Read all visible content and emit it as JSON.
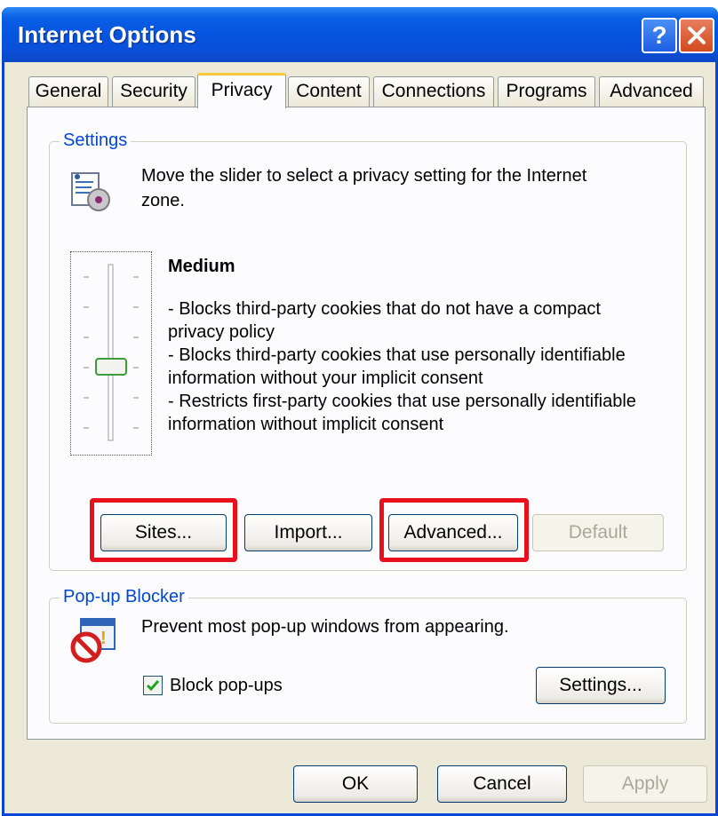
{
  "window": {
    "title": "Internet Options"
  },
  "tabs": [
    {
      "label": "General"
    },
    {
      "label": "Security"
    },
    {
      "label": "Privacy",
      "active": true
    },
    {
      "label": "Content"
    },
    {
      "label": "Connections"
    },
    {
      "label": "Programs"
    },
    {
      "label": "Advanced"
    }
  ],
  "settings": {
    "group_label": "Settings",
    "instruction_line1": "Move the slider to select a privacy setting for the Internet",
    "instruction_line2": "zone.",
    "level_title": "Medium",
    "slider_level": "3 of 6 (middle)",
    "description_lines": [
      "- Blocks third-party cookies that do not have a compact",
      "privacy policy",
      "- Blocks third-party cookies that use personally identifiable",
      "information without your implicit consent",
      "- Restricts first-party cookies that use personally identifiable",
      "information without implicit consent"
    ],
    "buttons": {
      "sites": "Sites...",
      "import": "Import...",
      "advanced": "Advanced...",
      "default": "Default"
    }
  },
  "popup_blocker": {
    "group_label": "Pop-up Blocker",
    "description": "Prevent most pop-up windows from appearing.",
    "checkbox_label": "Block pop-ups",
    "checkbox_checked": true,
    "settings_button": "Settings..."
  },
  "footer": {
    "ok": "OK",
    "cancel": "Cancel",
    "apply": "Apply"
  },
  "colors": {
    "titlebar": "#0554e0",
    "highlight": "#e8101c",
    "group_label": "#0046d5"
  }
}
